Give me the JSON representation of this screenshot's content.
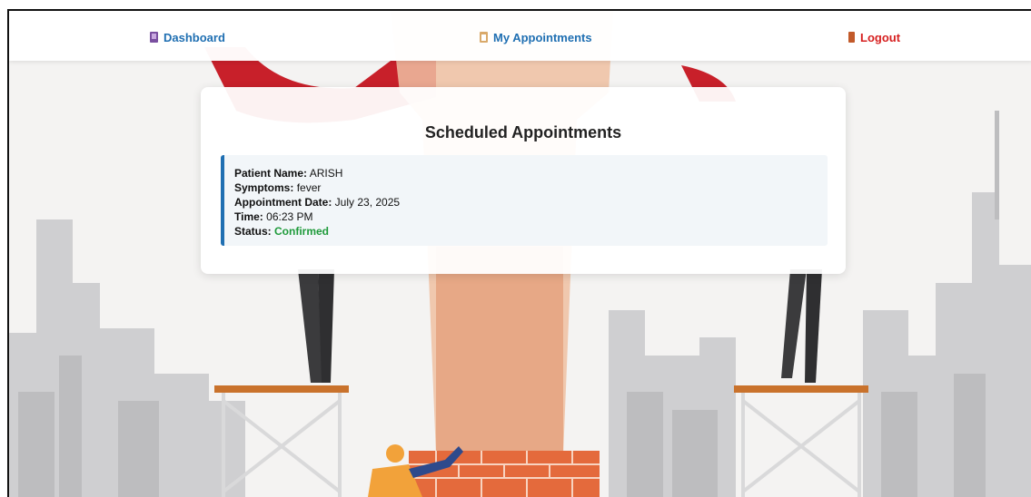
{
  "nav": {
    "dashboard": {
      "label": "Dashboard",
      "icon": "book-icon"
    },
    "appointments": {
      "label": "My Appointments",
      "icon": "clipboard-icon"
    },
    "logout": {
      "label": "Logout",
      "icon": "door-icon"
    }
  },
  "colors": {
    "nav_link": "#1f6fb2",
    "logout": "#d61f1f",
    "accent_border": "#1f6fb2",
    "status_confirmed": "#1e9a3a"
  },
  "main": {
    "title": "Scheduled Appointments",
    "appointments": [
      {
        "patient_name_label": "Patient Name:",
        "patient_name": "ARISH",
        "symptoms_label": "Symptoms:",
        "symptoms": "fever",
        "date_label": "Appointment Date:",
        "date": "July 23, 2025",
        "time_label": "Time:",
        "time": "06:23 PM",
        "status_label": "Status:",
        "status": "Confirmed"
      }
    ]
  }
}
